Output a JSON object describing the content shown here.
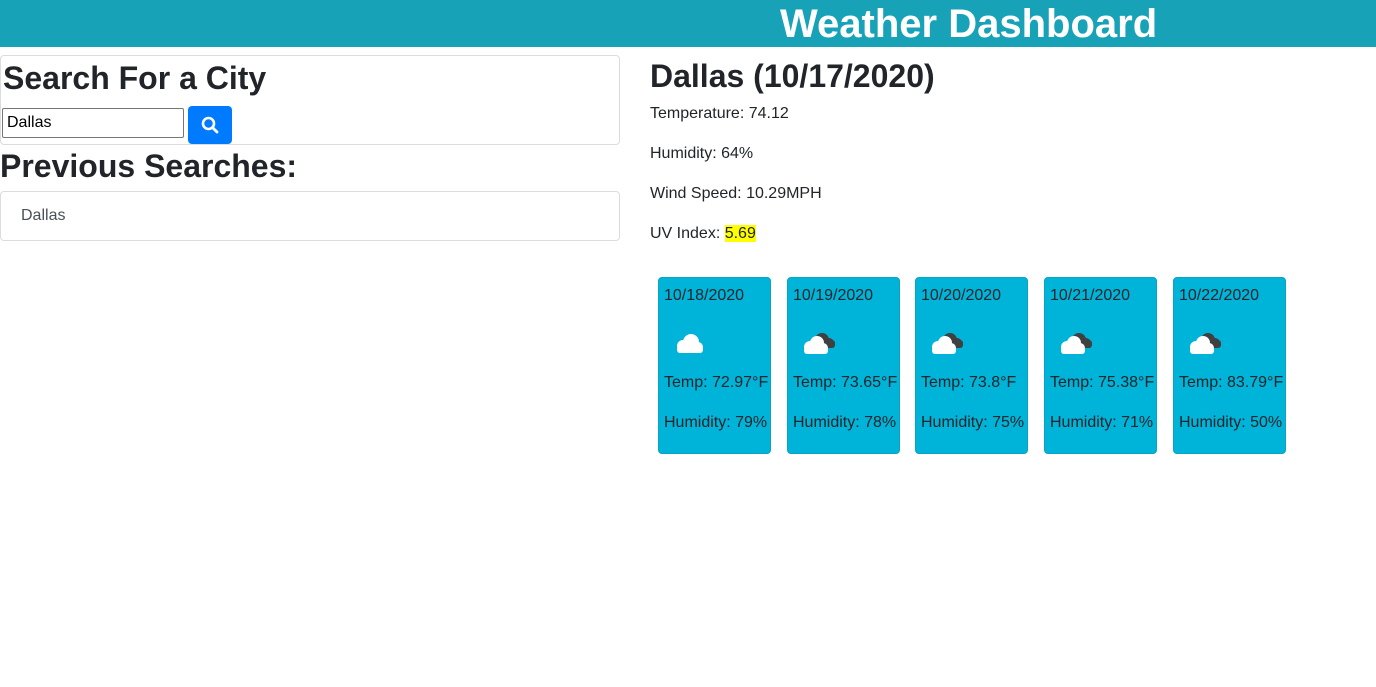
{
  "header": {
    "title": "Weather Dashboard"
  },
  "search": {
    "heading": "Search For a City",
    "input_value": "Dallas",
    "button_icon": "search-icon"
  },
  "history": {
    "heading": "Previous Searches:",
    "items": [
      "Dallas"
    ]
  },
  "current": {
    "title": "Dallas (10/17/2020)",
    "temperature_label": "Temperature: ",
    "temperature": "74.12",
    "humidity_label": "Humidity: ",
    "humidity": "64%",
    "wind_label": "Wind Speed: ",
    "wind": "10.29MPH",
    "uv_label": "UV Index: ",
    "uv": "5.69",
    "uv_color": "#ffff00"
  },
  "forecast": [
    {
      "date": "10/18/2020",
      "icon": "cloud-icon",
      "temp": "Temp: 72.97°F",
      "humidity": "Humidity: 79%"
    },
    {
      "date": "10/19/2020",
      "icon": "broken-clouds-icon",
      "temp": "Temp: 73.65°F",
      "humidity": "Humidity: 78%"
    },
    {
      "date": "10/20/2020",
      "icon": "broken-clouds-icon",
      "temp": "Temp: 73.8°F",
      "humidity": "Humidity: 75%"
    },
    {
      "date": "10/21/2020",
      "icon": "broken-clouds-icon",
      "temp": "Temp: 75.38°F",
      "humidity": "Humidity: 71%"
    },
    {
      "date": "10/22/2020",
      "icon": "broken-clouds-icon",
      "temp": "Temp: 83.79°F",
      "humidity": "Humidity: 50%"
    }
  ],
  "colors": {
    "header_bg": "#17a2b8",
    "search_button": "#007bff",
    "card_bg": "#00b3d8",
    "uv_highlight": "#ffff00"
  }
}
